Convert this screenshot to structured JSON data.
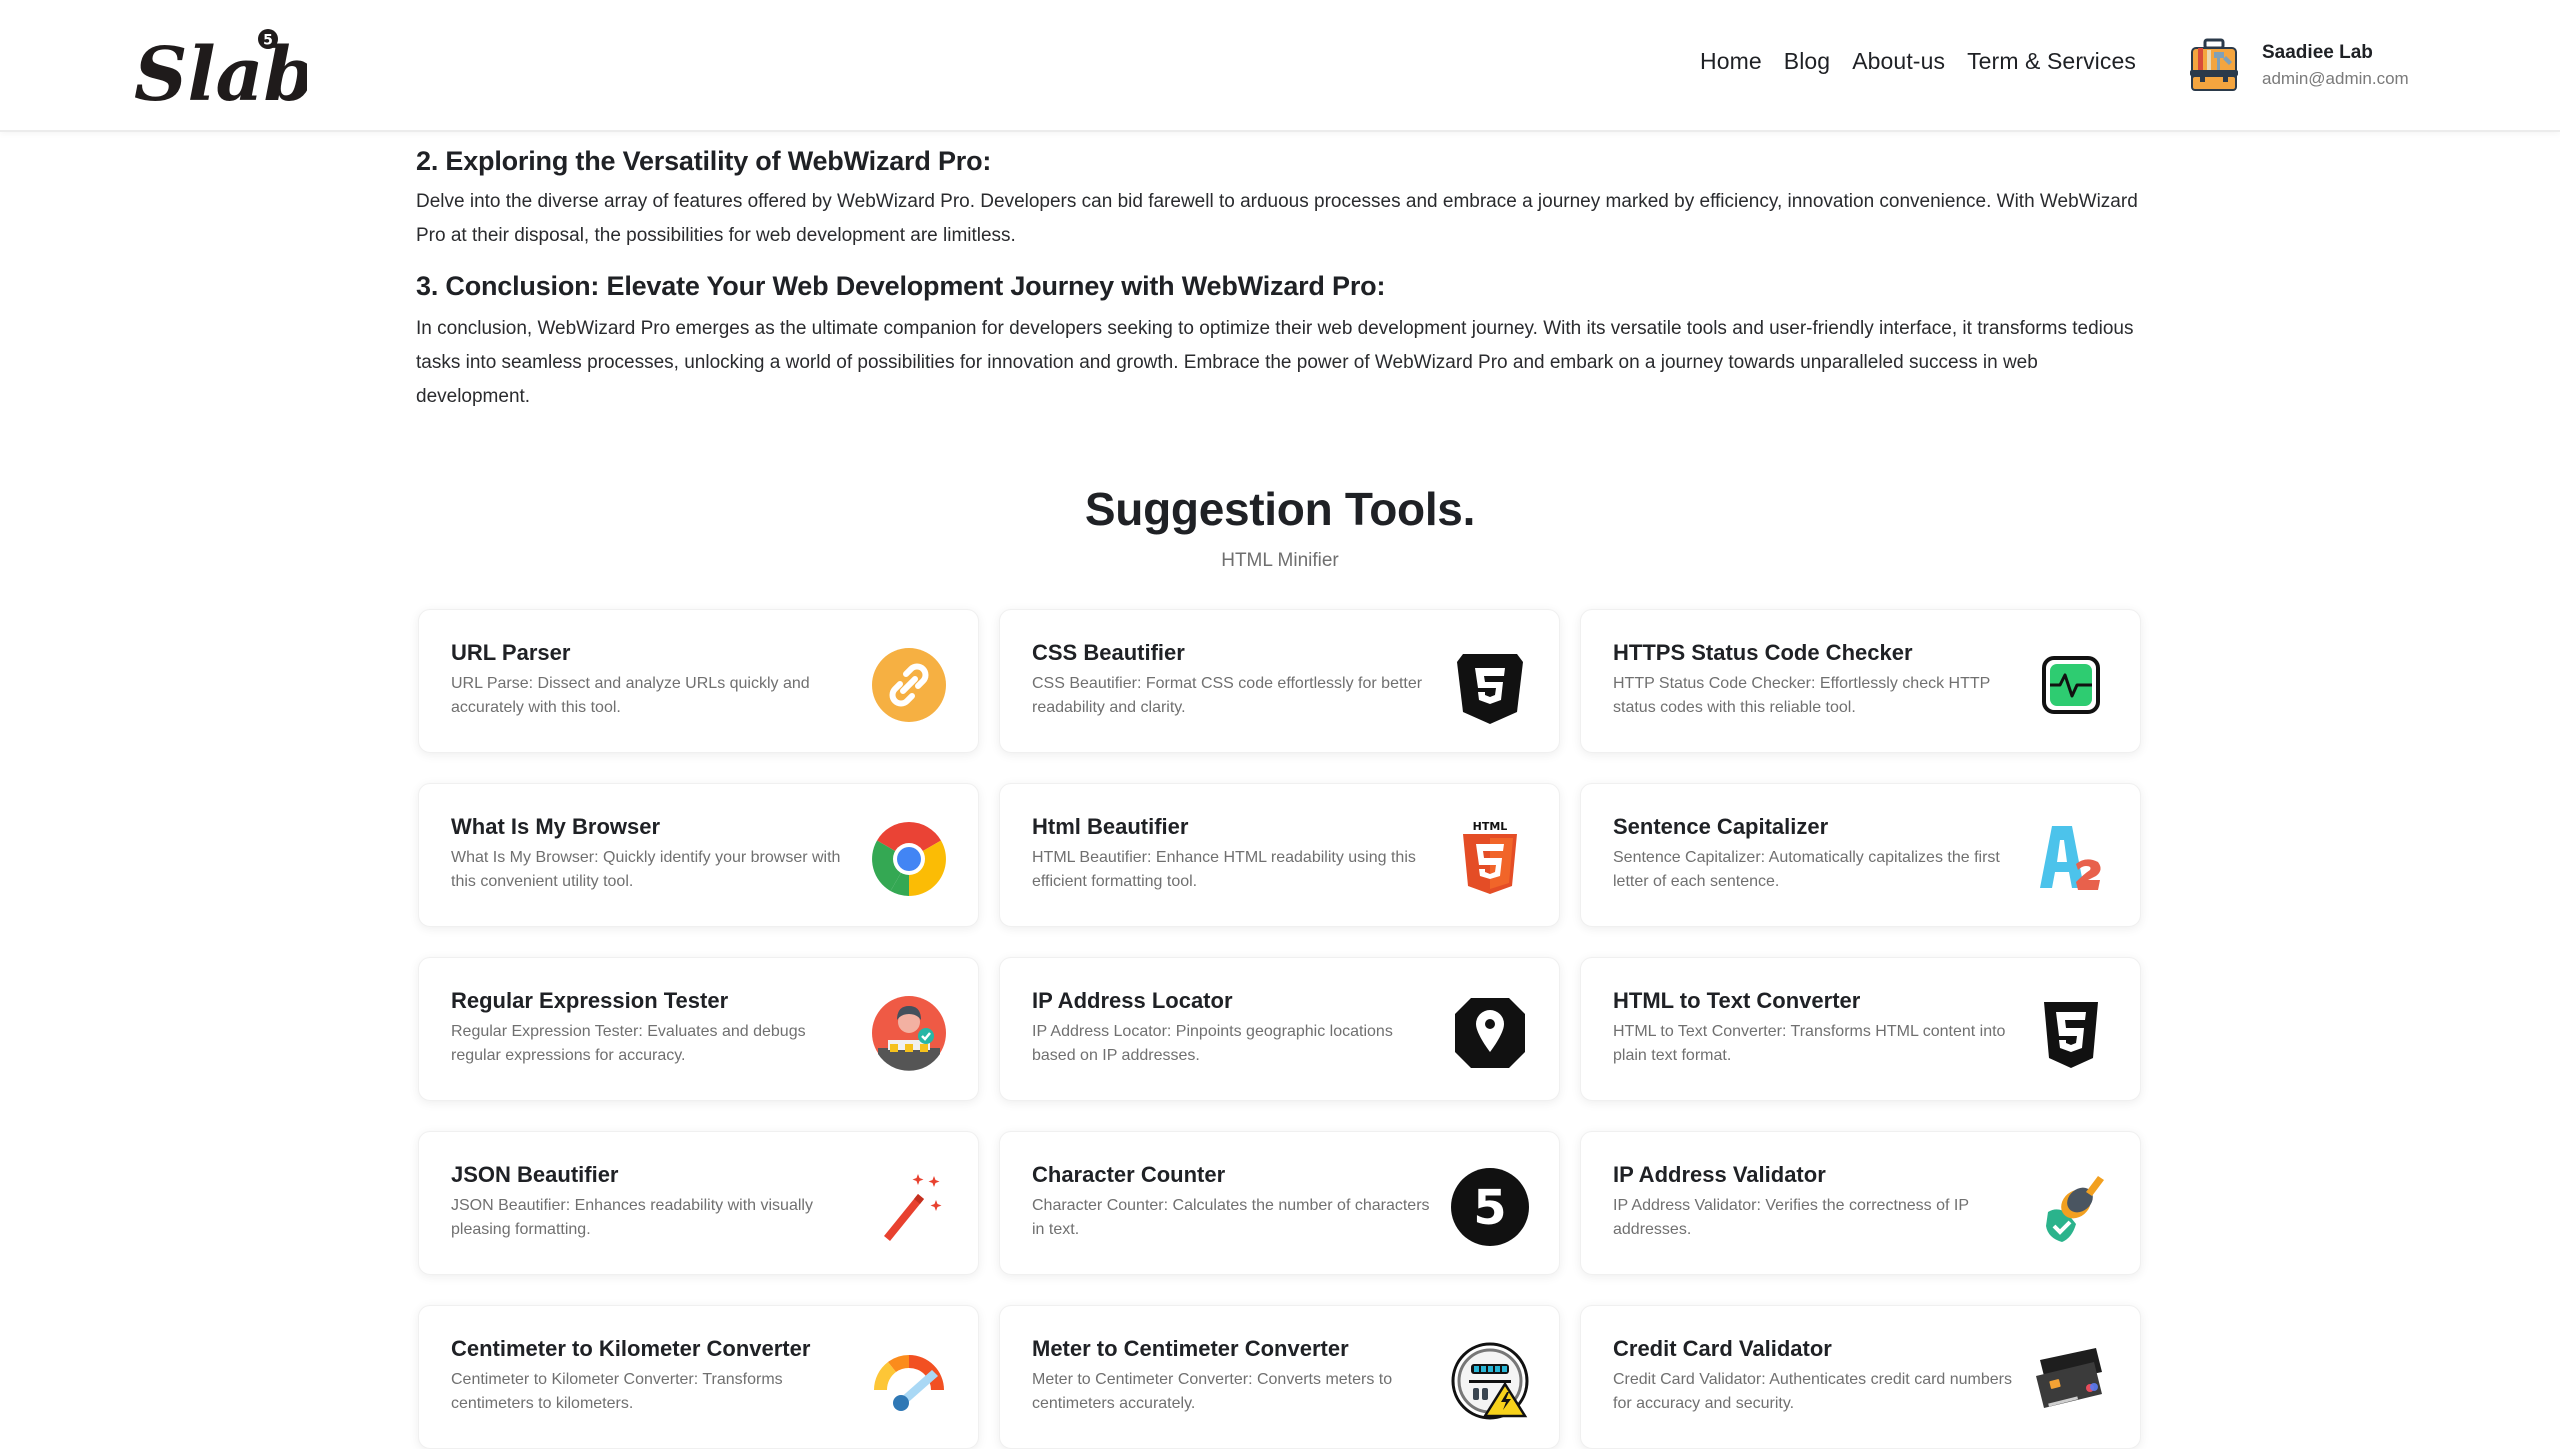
{
  "header": {
    "logo_text": "Slab",
    "logo_badge": "5",
    "nav": [
      {
        "label": "Home"
      },
      {
        "label": "Blog"
      },
      {
        "label": "About-us"
      },
      {
        "label": "Term & Services"
      }
    ],
    "user": {
      "name": "Saadiee Lab",
      "email": "admin@admin.com",
      "avatar_icon": "toolbox-icon"
    }
  },
  "article": {
    "section2": {
      "heading": "2. Exploring the Versatility of WebWizard Pro:",
      "body": "Delve into the diverse array of features offered by WebWizard Pro. Developers can bid farewell to arduous processes and embrace a journey marked by efficiency, innovation convenience. With WebWizard Pro at their disposal, the possibilities for web development are limitless."
    },
    "section3": {
      "heading": "3. Conclusion: Elevate Your Web Development Journey with WebWizard Pro:",
      "body": "In conclusion, WebWizard Pro emerges as the ultimate companion for developers seeking to optimize their web development journey. With its versatile tools and user-friendly interface, it transforms tedious tasks into seamless processes, unlocking a world of possibilities for innovation and growth. Embrace the power of WebWizard Pro and embark on a journey towards unparalleled success in web development."
    }
  },
  "suggestions": {
    "title": "Suggestion Tools.",
    "subtitle": "HTML Minifier",
    "tools": [
      {
        "title": "URL Parser",
        "desc": "URL Parse: Dissect and analyze URLs quickly and accurately with this tool.",
        "icon": "link-icon"
      },
      {
        "title": "CSS Beautifier",
        "desc": "CSS Beautifier: Format CSS code effortlessly for better readability and clarity.",
        "icon": "css3-icon"
      },
      {
        "title": "HTTPS Status Code Checker",
        "desc": "HTTP Status Code Checker: Effortlessly check HTTP status codes with this reliable tool.",
        "icon": "pulse-monitor-icon"
      },
      {
        "title": "What Is My Browser",
        "desc": "What Is My Browser: Quickly identify your browser with this convenient utility tool.",
        "icon": "chrome-icon"
      },
      {
        "title": "Html Beautifier",
        "desc": "HTML Beautifier: Enhance HTML readability using this efficient formatting tool.",
        "icon": "html5-icon"
      },
      {
        "title": "Sentence Capitalizer",
        "desc": "Sentence Capitalizer: Automatically capitalizes the first letter of each sentence.",
        "icon": "letter-case-icon"
      },
      {
        "title": "Regular Expression Tester",
        "desc": "Regular Expression Tester: Evaluates and debugs regular expressions for accuracy.",
        "icon": "verified-user-icon"
      },
      {
        "title": "IP Address Locator",
        "desc": "IP Address Locator: Pinpoints geographic locations based on IP addresses.",
        "icon": "location-pin-icon"
      },
      {
        "title": "HTML to Text Converter",
        "desc": "HTML to Text Converter: Transforms HTML content into plain text format.",
        "icon": "html5-outline-icon"
      },
      {
        "title": "JSON Beautifier",
        "desc": "JSON Beautifier: Enhances readability with visually pleasing formatting.",
        "icon": "magic-wand-icon"
      },
      {
        "title": "Character Counter",
        "desc": "Character Counter: Calculates the number of characters in text.",
        "icon": "number-five-icon"
      },
      {
        "title": "IP Address Validator",
        "desc": "IP Address Validator: Verifies the correctness of IP addresses.",
        "icon": "stamp-check-icon"
      },
      {
        "title": "Centimeter to Kilometer Converter",
        "desc": "Centimeter to Kilometer Converter: Transforms centimeters to kilometers.",
        "icon": "gauge-icon"
      },
      {
        "title": "Meter to Centimeter Converter",
        "desc": "Meter to Centimeter Converter: Converts meters to centimeters accurately.",
        "icon": "electric-meter-icon"
      },
      {
        "title": "Credit Card Validator",
        "desc": "Credit Card Validator: Authenticates credit card numbers for accuracy and security.",
        "icon": "credit-card-icon"
      }
    ]
  },
  "colors": {
    "text_primary": "#1f2125",
    "text_muted": "#707070",
    "link_orange": "#f6b042",
    "html5_orange": "#f0592a",
    "status_green": "#2ecc71"
  }
}
